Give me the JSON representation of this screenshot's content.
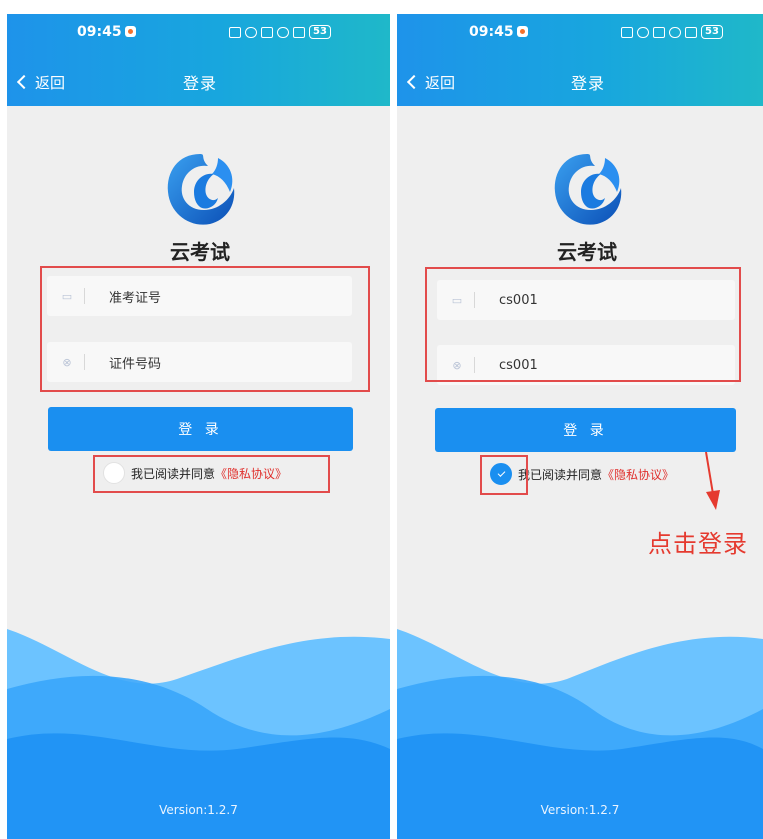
{
  "screens": [
    {
      "status_time": "09:45",
      "battery": "53",
      "back_label": "返回",
      "nav_title": "登录",
      "app_name": "云考试",
      "field1_value": "准考证号",
      "field2_value": "证件号码",
      "login_label": "登 录",
      "agree_text": "我已阅读并同意",
      "privacy_link": "《隐私协议》",
      "agree_checked": false,
      "version": "Version:1.2.7"
    },
    {
      "status_time": "09:45",
      "battery": "53",
      "back_label": "返回",
      "nav_title": "登录",
      "app_name": "云考试",
      "field1_value": "cs001",
      "field2_value": "cs001",
      "login_label": "登 录",
      "agree_text": "我已阅读并同意",
      "privacy_link": "《隐私协议》",
      "agree_checked": true,
      "version": "Version:1.2.7"
    }
  ],
  "annotation": {
    "hint": "点击登录"
  },
  "colors": {
    "header_start": "#1e93ea",
    "header_end": "#1fb8c9",
    "primary": "#1a8ff0",
    "link": "#e0302d",
    "annotation": "#e53a2f"
  }
}
